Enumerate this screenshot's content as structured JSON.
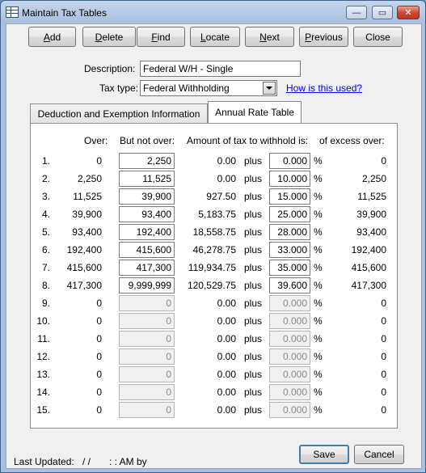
{
  "window": {
    "title": "Maintain Tax Tables",
    "controls": {
      "minimize": "—",
      "maximize": "▭",
      "close": "✕"
    }
  },
  "toolbar": {
    "buttons": [
      {
        "ul": "A",
        "rest": "dd"
      },
      {
        "ul": "D",
        "rest": "elete"
      },
      {
        "ul": "F",
        "rest": "ind"
      },
      {
        "ul": "L",
        "rest": "ocate"
      },
      {
        "ul": "N",
        "rest": "ext"
      },
      {
        "ul": "P",
        "rest": "revious"
      },
      {
        "ul": "",
        "rest": "Close"
      }
    ]
  },
  "form": {
    "description_label": "Description:",
    "description_value": "Federal W/H - Single",
    "tax_type_label": "Tax type:",
    "tax_type_value": "Federal Withholding",
    "help_link": "How is this used?"
  },
  "tabs": [
    {
      "label": "Deduction and Exemption Information",
      "active": false
    },
    {
      "label": "Annual Rate Table",
      "active": true
    }
  ],
  "rate_table": {
    "headers": {
      "over": "Over:",
      "not_over": "But not over:",
      "amount": "Amount of tax to withhold is:",
      "excess": "of excess over:"
    },
    "plus_label": "plus",
    "pct_label": "%",
    "rows": [
      {
        "n": "1.",
        "over": "0",
        "not_over": "2,250",
        "amount": "0.00",
        "rate": "0.000",
        "excess": "0",
        "enabled": true
      },
      {
        "n": "2.",
        "over": "2,250",
        "not_over": "11,525",
        "amount": "0.00",
        "rate": "10.000",
        "excess": "2,250",
        "enabled": true
      },
      {
        "n": "3.",
        "over": "11,525",
        "not_over": "39,900",
        "amount": "927.50",
        "rate": "15.000",
        "excess": "11,525",
        "enabled": true
      },
      {
        "n": "4.",
        "over": "39,900",
        "not_over": "93,400",
        "amount": "5,183.75",
        "rate": "25.000",
        "excess": "39,900",
        "enabled": true
      },
      {
        "n": "5.",
        "over": "93,400",
        "not_over": "192,400",
        "amount": "18,558.75",
        "rate": "28.000",
        "excess": "93,400",
        "enabled": true
      },
      {
        "n": "6.",
        "over": "192,400",
        "not_over": "415,600",
        "amount": "46,278.75",
        "rate": "33.000",
        "excess": "192,400",
        "enabled": true
      },
      {
        "n": "7.",
        "over": "415,600",
        "not_over": "417,300",
        "amount": "119,934.75",
        "rate": "35.000",
        "excess": "415,600",
        "enabled": true
      },
      {
        "n": "8.",
        "over": "417,300",
        "not_over": "9,999,999",
        "amount": "120,529.75",
        "rate": "39.600",
        "excess": "417,300",
        "enabled": true
      },
      {
        "n": "9.",
        "over": "0",
        "not_over": "0",
        "amount": "0.00",
        "rate": "0.000",
        "excess": "0",
        "enabled": false
      },
      {
        "n": "10.",
        "over": "0",
        "not_over": "0",
        "amount": "0.00",
        "rate": "0.000",
        "excess": "0",
        "enabled": false
      },
      {
        "n": "11.",
        "over": "0",
        "not_over": "0",
        "amount": "0.00",
        "rate": "0.000",
        "excess": "0",
        "enabled": false
      },
      {
        "n": "12.",
        "over": "0",
        "not_over": "0",
        "amount": "0.00",
        "rate": "0.000",
        "excess": "0",
        "enabled": false
      },
      {
        "n": "13.",
        "over": "0",
        "not_over": "0",
        "amount": "0.00",
        "rate": "0.000",
        "excess": "0",
        "enabled": false
      },
      {
        "n": "14.",
        "over": "0",
        "not_over": "0",
        "amount": "0.00",
        "rate": "0.000",
        "excess": "0",
        "enabled": false
      },
      {
        "n": "15.",
        "over": "0",
        "not_over": "0",
        "amount": "0.00",
        "rate": "0.000",
        "excess": "0",
        "enabled": false
      }
    ]
  },
  "footer": {
    "last_updated_label": "Last Updated:",
    "date_value": "/  /",
    "time_value": ":  :  AM by",
    "save_label": "Save",
    "cancel_label": "Cancel"
  },
  "colors": {
    "frame": "#a9c1df",
    "client_bg": "#f0f0f0",
    "link": "#0000ee",
    "close_button": "#c8452e"
  }
}
